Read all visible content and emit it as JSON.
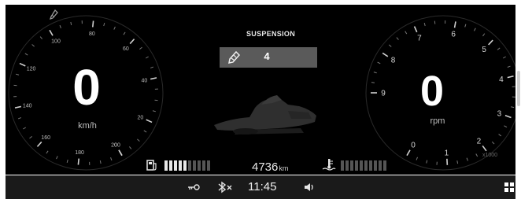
{
  "speedometer": {
    "value": "0",
    "unit": "km/h",
    "ticks": [
      "0",
      "20",
      "40",
      "60",
      "80",
      "100",
      "120",
      "140",
      "160",
      "180",
      "200"
    ]
  },
  "tachometer": {
    "value": "0",
    "unit": "rpm",
    "ticks": [
      "0",
      "1",
      "2",
      "3",
      "4",
      "5",
      "6",
      "7",
      "8",
      "9"
    ],
    "multiplier": "x1000"
  },
  "suspension": {
    "title": "SUSPENSION",
    "value": "4",
    "icon": "suspension-icon"
  },
  "fuel": {
    "icon": "fuel-pump-icon",
    "level_segments": 5,
    "total_segments": 10
  },
  "coolant": {
    "icon": "coolant-temperature-icon",
    "level_segments": 0,
    "total_segments": 10
  },
  "odometer": {
    "value": "4736",
    "unit": "km"
  },
  "status_bar": {
    "time": "11:45",
    "icons": [
      "key-icon",
      "bluetooth-off-icon",
      "volume-icon",
      "grid-menu-icon"
    ]
  },
  "colors": {
    "background": "#000000",
    "status_bar": "#1a1a1a",
    "selection": "#5a5a5a"
  }
}
